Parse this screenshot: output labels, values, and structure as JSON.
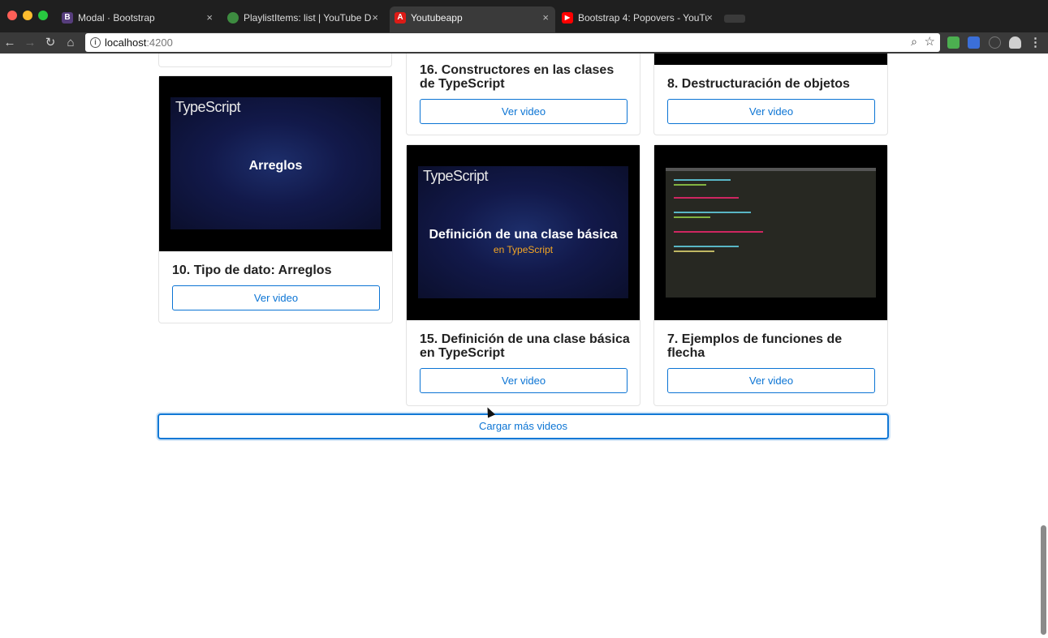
{
  "browser": {
    "tabs": [
      {
        "title": "Modal · Bootstrap",
        "favicon": "B",
        "favicon_color": "#563d7c"
      },
      {
        "title": "PlaylistItems: list  |  YouTube D",
        "favicon": "",
        "favicon_color": "#3d8b40"
      },
      {
        "title": "Youtubeapp",
        "favicon": "A",
        "favicon_color": "#dd1b16"
      },
      {
        "title": "Bootstrap 4: Popovers - YouTu",
        "favicon": "▶",
        "favicon_color": "#ff0000"
      }
    ],
    "tab_close": "×",
    "address": {
      "host": "localhost",
      "port": ":4200"
    },
    "icons": {
      "back": "←",
      "forward": "→",
      "reload": "↻",
      "home": "⌂",
      "zoom": "⌕",
      "bookmark": "☆",
      "menu": "⋮"
    }
  },
  "page": {
    "cards": [
      {
        "title": "10. Tipo de dato: Arreglos",
        "thumb_brand": "TypeScript",
        "thumb_text": "Arreglos",
        "button": "Ver video"
      },
      {
        "title": "16. Constructores en las clases de TypeScript",
        "button": "Ver video"
      },
      {
        "title": "8. Destructuración de objetos",
        "button": "Ver video"
      },
      {
        "title": "15. Definición de una clase básica en TypeScript",
        "thumb_brand": "TypeScript",
        "thumb_text": "Definición de una clase básica",
        "thumb_sub": "en TypeScript",
        "button": "Ver video"
      },
      {
        "title": "7. Ejemplos de funciones de flecha",
        "button": "Ver video"
      }
    ],
    "load_more": "Cargar más videos"
  },
  "colors": {
    "primary": "#0b74d4",
    "chrome_dark": "#1f1f1f",
    "chrome_toolbar": "#3a3a3a"
  }
}
